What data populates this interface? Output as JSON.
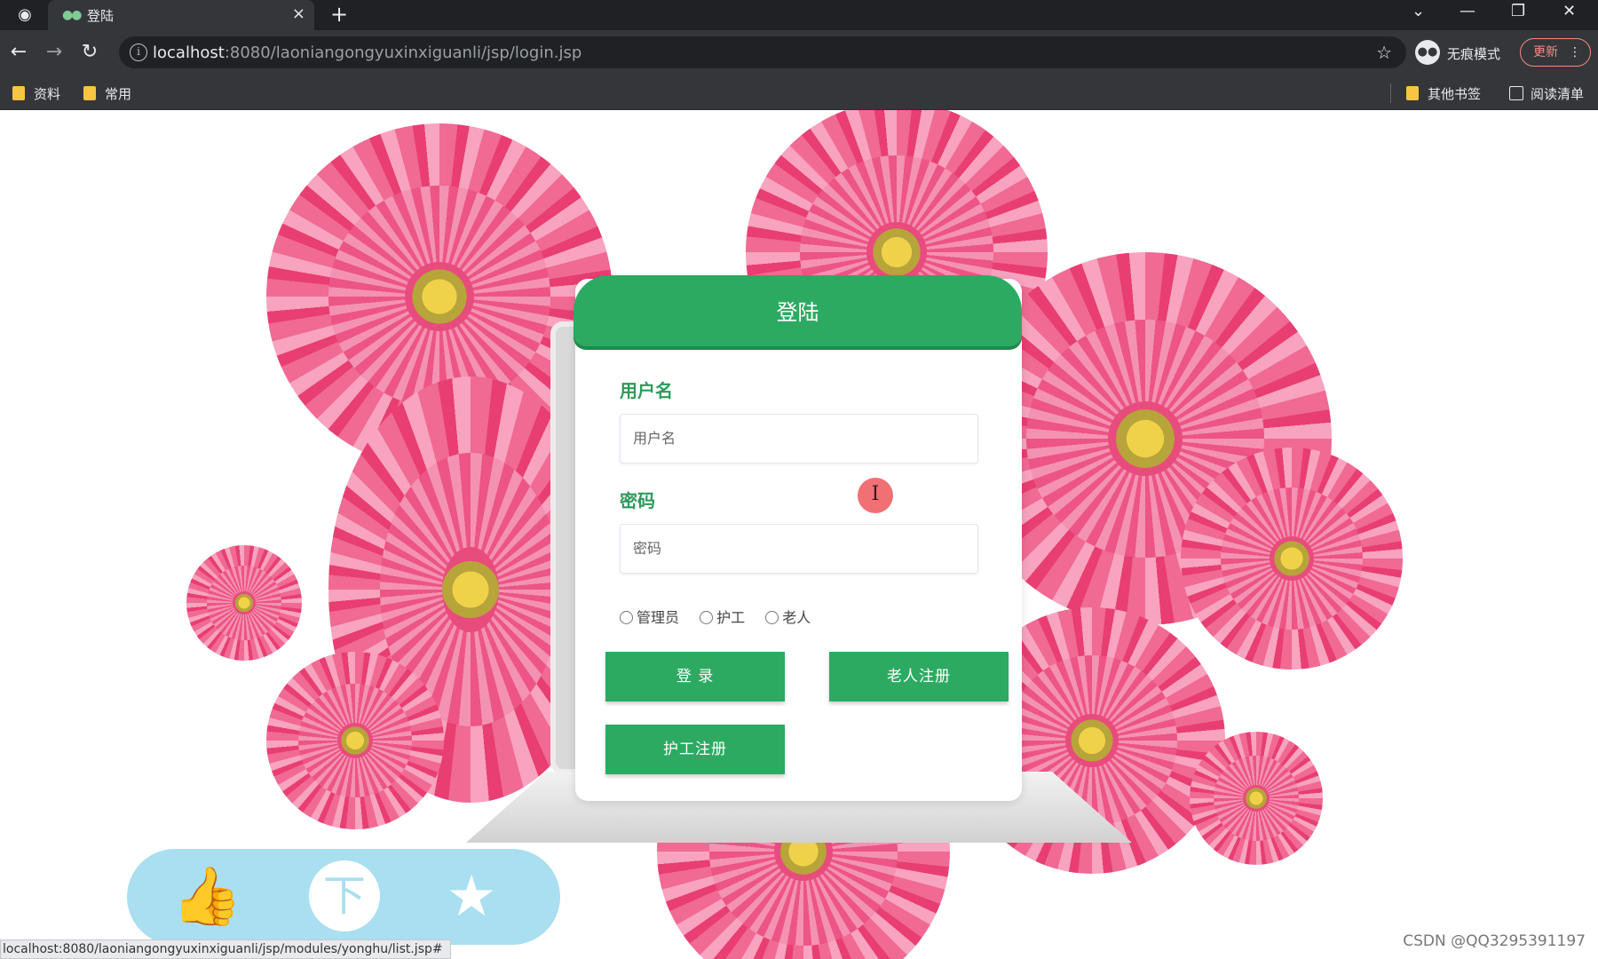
{
  "browser": {
    "tab_title": "登陆",
    "tab_close": "×",
    "new_tab": "+",
    "url_host": "localhost",
    "url_rest": ":8080/laoniangongyuxinxiguanli/jsp/login.jsp",
    "incognito_label": "无痕模式",
    "update_label": "更新",
    "bookmarks": [
      "资料",
      "常用"
    ],
    "other_bookmarks": "其他书签",
    "reading_list": "阅读清单",
    "icons": [
      "globe-icon",
      "back-arrow-icon",
      "forward-arrow-icon",
      "reload-icon",
      "info-icon",
      "star-icon",
      "incognito-icon",
      "folder-icon",
      "reading-list-icon",
      "minimize-icon",
      "restore-icon",
      "close-icon",
      "chevron-down-icon"
    ]
  },
  "login": {
    "title": "登陆",
    "username_label": "用户名",
    "username_placeholder": "用户名",
    "password_label": "密码",
    "password_placeholder": "密码",
    "roles": [
      "管理员",
      "护工",
      "老人"
    ],
    "login_button": "登 录",
    "elder_register_button": "老人注册",
    "nurse_register_button": "护工注册"
  },
  "colors": {
    "primary_green": "#2daa62",
    "label_green": "#2d9a5a",
    "flower_pink": "#e83e72",
    "social_bar": "#a9dff0"
  },
  "social_icons": [
    "thumbs-up-icon",
    "coin-icon",
    "favorite-star-icon"
  ],
  "status_url": "localhost:8080/laoniangongyuxinxiguanli/jsp/modules/yonghu/list.jsp#",
  "watermark": "CSDN @QQ3295391197"
}
